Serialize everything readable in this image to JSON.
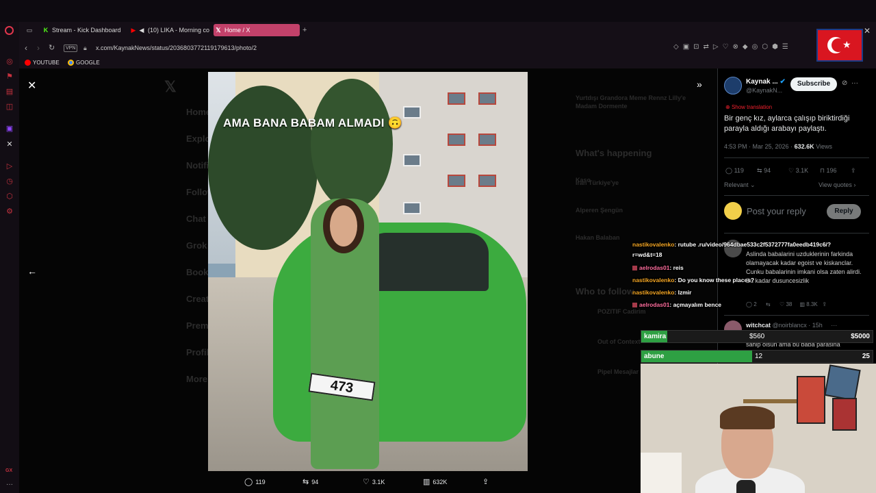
{
  "browser": {
    "tabs": [
      {
        "label": "Stream - Kick Dashboard",
        "favicon": "kick-icon",
        "color": "#53fc18"
      },
      {
        "label": "(10) LIKA - Morning co",
        "favicon": "youtube-icon",
        "color": "#ff0000"
      },
      {
        "label": "Home / X",
        "favicon": "x-icon",
        "color": "#ffffff",
        "active": true
      }
    ],
    "new_tab": "+",
    "url": "x.com/KaynakNews/status/2036803772119179613/photo/2",
    "vpn": "VPN",
    "bookmarks": [
      {
        "label": "YOUTUBE",
        "color": "#ff0000"
      },
      {
        "label": "GOOGLE",
        "color": "#4285f4"
      }
    ]
  },
  "viewer": {
    "image_caption": "AMA BANA BABAM ALMADI 🙃",
    "plate_text": "473",
    "actions": {
      "replies": "119",
      "reposts": "94",
      "likes": "3.1K",
      "views": "632K"
    }
  },
  "ghost_sidebar": [
    "Home",
    "Explore",
    "Notifications",
    "Follow",
    "Chat",
    "Grok",
    "Bookmarks",
    "Creator Studio",
    "Premium",
    "Profile",
    "More"
  ],
  "ghost_right": [
    "Yurtdışı Grandora Meme Rennz Lilly'e",
    "Madam Dormente",
    "What's happening",
    "Kaso",
    "Iran Türkiye'ye",
    "Alperen Şengün",
    "Hakan Balaban",
    "Who to follow",
    "POZITIF Cadirim",
    "Out of Context",
    "Pipel Mesajlar"
  ],
  "tweet": {
    "author": "Kaynak ...",
    "handle": "@KaynakN...",
    "subscribe": "Subscribe",
    "show_translation": "Show translation",
    "text": "Bir genç kız, aylarca çalışıp biriktirdiği parayla aldığı arabayı paylaştı.",
    "time": "4:53 PM · Mar 25, 2026 ·",
    "views_count": "632.6K",
    "views_label": "Views",
    "stats": {
      "replies": "119",
      "reposts": "94",
      "likes": "3.1K",
      "bookmarks": "196"
    },
    "sort": "Relevant",
    "view_quotes": "View quotes",
    "reply_placeholder": "Post your reply",
    "reply_button": "Reply"
  },
  "comments": [
    {
      "text": "Aslinda babalarini uzduklerinin farkinda olamayacak kadar egoist ve kiskanclar. Cunku babalarinin imkani olsa zaten alirdi. Bu kadar dusuncesizlik",
      "stats": {
        "replies": "2",
        "likes": "38",
        "views": "8.3K"
      }
    },
    {
      "name": "witchcat",
      "handle": "@noirblancx · 15h",
      "text": "sahip olsun ama bu baba parasina"
    }
  ],
  "chat": [
    {
      "user": "nastikovalenko",
      "message": ": rutube .ru/video/964dbae533c2f5372777fa0eedb419c6/?",
      "continuation": "r=wd&t=18",
      "badge": false
    },
    {
      "user": "aelrodas01",
      "message": ": reis",
      "badge": true
    },
    {
      "user": "nastikovalenko",
      "message": ": Do you know these places?",
      "badge": false
    },
    {
      "user": "nastikovalenko",
      "message": ": Izmir",
      "badge": false
    },
    {
      "user": "aelrodas01",
      "message": ": açmayalım bence",
      "badge": true
    }
  ],
  "goals": [
    {
      "label": "kamira",
      "current": "$560",
      "target": "$5000",
      "progress": 0.112,
      "color": "#2ea043"
    },
    {
      "label": "abune",
      "current": "12",
      "target": "25",
      "progress": 0.48,
      "color": "#2ea043"
    }
  ],
  "rail": {
    "gx": "GX",
    "more": "···"
  },
  "colors": {
    "accent": "#c2416a",
    "opera_red": "#e0364c",
    "x_blue": "#1d9bf0",
    "kick_green": "#53fc18"
  }
}
